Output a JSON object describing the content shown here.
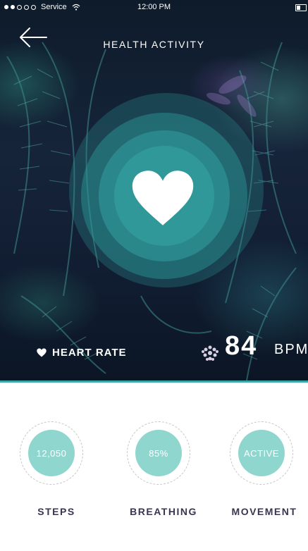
{
  "status_bar": {
    "carrier": "Service",
    "time": "12:00 PM"
  },
  "header": {
    "title": "HEALTH ACTIVITY",
    "back_icon": "arrow-left-icon"
  },
  "heart_rate": {
    "label": "HEART RATE",
    "value": "84",
    "unit": "BPM",
    "icon": "heart-icon"
  },
  "metrics": [
    {
      "value": "12,050",
      "label": "STEPS"
    },
    {
      "value": "85%",
      "label": "BREATHING"
    },
    {
      "value": "ACTIVE",
      "label": "MOVEMENT"
    }
  ],
  "colors": {
    "accent": "#3ba7ad",
    "metric_fill": "#8fd6cf",
    "label_text": "#3b3550"
  }
}
